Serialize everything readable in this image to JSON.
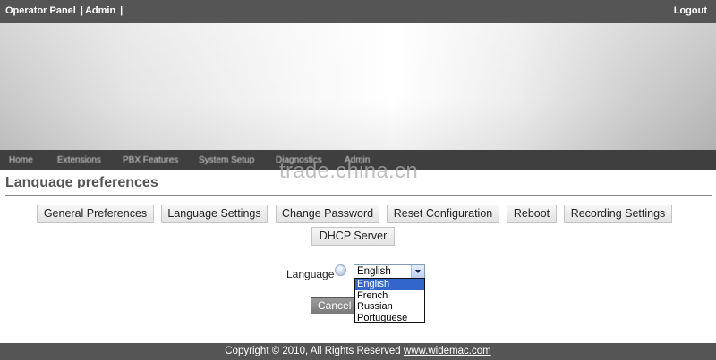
{
  "topbar": {
    "links": [
      "Operator Panel",
      "Admin"
    ],
    "separator": "|",
    "logout": "Logout"
  },
  "nav": {
    "items": [
      "Home",
      "Extensions",
      "PBX Features",
      "System Setup",
      "Diagnostics",
      "Admin"
    ]
  },
  "watermark": "trade.china.cn",
  "section_title": "Language preferences",
  "tabs": {
    "general": "General Preferences",
    "language": "Language Settings",
    "password": "Change Password",
    "reset": "Reset Configuration",
    "reboot": "Reboot",
    "recording": "Recording Settings",
    "dhcp": "DHCP Server"
  },
  "form": {
    "language_label": "Language",
    "help_icon": "question-mark",
    "selected": "English",
    "options": [
      "English",
      "French",
      "Russian",
      "Portuguese"
    ],
    "cancel": "Cancel"
  },
  "footer": {
    "text": "Copyright © 2010, All Rights Reserved",
    "link": "www.widemac.com"
  },
  "colors": {
    "topbar": "#555555",
    "navbar": "#3f3f3f",
    "selected_option": "#3366cc"
  }
}
